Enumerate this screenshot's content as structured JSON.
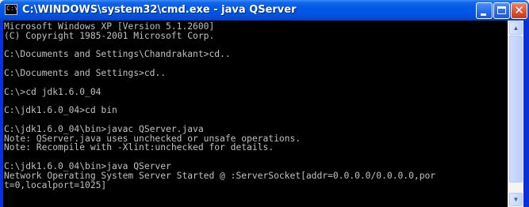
{
  "window": {
    "title": "C:\\WINDOWS\\system32\\cmd.exe - java QServer",
    "icon": "cmd-icon",
    "icon_label": "C:\\",
    "controls": {
      "minimize_icon": "minimize-icon",
      "maximize_icon": "maximize-icon",
      "close_icon": "close-icon",
      "close_glyph": "✕"
    }
  },
  "console": {
    "text": "Microsoft Windows XP [Version 5.1.2600]\n(C) Copyright 1985-2001 Microsoft Corp.\n\nC:\\Documents and Settings\\Chandrakant>cd..\n\nC:\\Documents and Settings>cd..\n\nC:\\>cd jdk1.6.0_04\n\nC:\\jdk1.6.0_04>cd bin\n\nC:\\jdk1.6.0_04\\bin>javac QServer.java\nNote: QServer.java uses unchecked or unsafe operations.\nNote: Recompile with -Xlint:unchecked for details.\n\nC:\\jdk1.6.0_04\\bin>java QServer\nNetwork Operating System Server Started @ :ServerSocket[addr=0.0.0.0/0.0.0.0,por\nt=0,localport=1025]",
    "background": "#000000",
    "foreground": "#c0c0c0"
  },
  "scrollbar": {
    "up_glyph": "▲",
    "down_glyph": "▼"
  },
  "colors": {
    "titlebar": "#0054e3",
    "close_button": "#e2583a"
  }
}
